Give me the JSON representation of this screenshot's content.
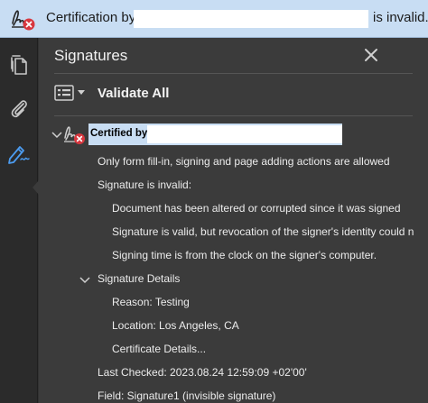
{
  "banner": {
    "text_prefix": "Certification by",
    "text_suffix": "is invalid."
  },
  "panel": {
    "title": "Signatures",
    "validate_all_label": "Validate All",
    "certified_by_label": "Certified by"
  },
  "details": {
    "permissions": "Only form fill-in, signing and page adding actions are allowed",
    "status": "Signature is invalid:",
    "reasons": [
      "Document has been altered or corrupted since it was signed",
      "Signature is valid, but revocation of the signer's identity could n",
      "Signing time is from the clock on the signer's computer."
    ],
    "signature_details_label": "Signature Details",
    "signature_details": [
      "Reason: Testing",
      "Location: Los Angeles, CA",
      "Certificate Details..."
    ],
    "last_checked": "Last Checked: 2023.08.24 12:59:09 +02'00'",
    "field": "Field: Signature1 (invisible signature)"
  },
  "icons": {
    "banner": "signature-invalid-icon",
    "rail": [
      "pages-icon",
      "attachments-icon",
      "signatures-icon"
    ],
    "close": "close-icon"
  },
  "colors": {
    "banner_bg": "#c8ddf3",
    "panel_bg": "#3b3b3b",
    "error_red": "#d7373f",
    "active_blue": "#4c9cf0"
  }
}
